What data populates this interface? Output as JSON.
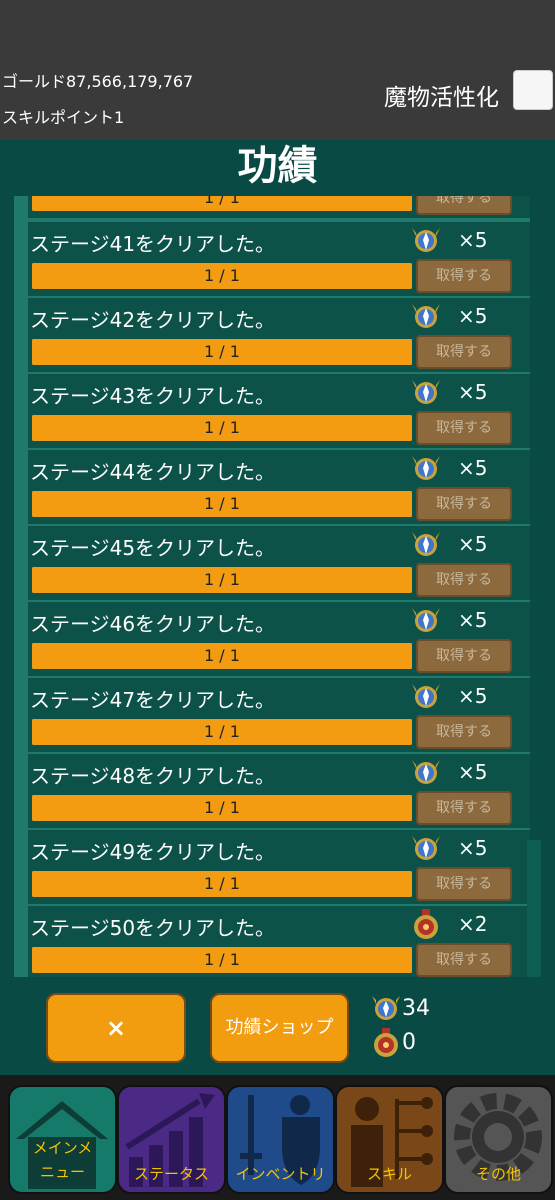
{
  "header": {
    "gold_label": "ゴールド87,566,179,767",
    "skill_point_label": "スキルポイント1",
    "monster_toggle_label": "魔物活性化"
  },
  "panel": {
    "title": "功績",
    "partial_top_row": {
      "progress": "1 / 1",
      "button": "取得する",
      "fraction": 1.0
    },
    "rows": [
      {
        "title": "ステージ41をクリアした。",
        "reward_icon": "blue-medal-icon",
        "multiplier": "×5",
        "progress": "1 / 1",
        "button": "取得する",
        "fraction": 1.0
      },
      {
        "title": "ステージ42をクリアした。",
        "reward_icon": "blue-medal-icon",
        "multiplier": "×5",
        "progress": "1 / 1",
        "button": "取得する",
        "fraction": 1.0
      },
      {
        "title": "ステージ43をクリアした。",
        "reward_icon": "blue-medal-icon",
        "multiplier": "×5",
        "progress": "1 / 1",
        "button": "取得する",
        "fraction": 1.0
      },
      {
        "title": "ステージ44をクリアした。",
        "reward_icon": "blue-medal-icon",
        "multiplier": "×5",
        "progress": "1 / 1",
        "button": "取得する",
        "fraction": 1.0
      },
      {
        "title": "ステージ45をクリアした。",
        "reward_icon": "blue-medal-icon",
        "multiplier": "×5",
        "progress": "1 / 1",
        "button": "取得する",
        "fraction": 1.0
      },
      {
        "title": "ステージ46をクリアした。",
        "reward_icon": "blue-medal-icon",
        "multiplier": "×5",
        "progress": "1 / 1",
        "button": "取得する",
        "fraction": 1.0
      },
      {
        "title": "ステージ47をクリアした。",
        "reward_icon": "blue-medal-icon",
        "multiplier": "×5",
        "progress": "1 / 1",
        "button": "取得する",
        "fraction": 1.0
      },
      {
        "title": "ステージ48をクリアした。",
        "reward_icon": "blue-medal-icon",
        "multiplier": "×5",
        "progress": "1 / 1",
        "button": "取得する",
        "fraction": 1.0
      },
      {
        "title": "ステージ49をクリアした。",
        "reward_icon": "blue-medal-icon",
        "multiplier": "×5",
        "progress": "1 / 1",
        "button": "取得する",
        "fraction": 1.0
      },
      {
        "title": "ステージ50をクリアした。",
        "reward_icon": "red-medal-icon",
        "multiplier": "×2",
        "progress": "1 / 1",
        "button": "取得する",
        "fraction": 1.0
      }
    ],
    "close_label": "×",
    "shop_label": "功績ショップ",
    "blue_medal_count": "34",
    "red_medal_count": "0"
  },
  "nav": {
    "items": [
      {
        "label": "メインメニュー",
        "line1": "メインメ",
        "line2": "ニュー",
        "icon": "house-icon",
        "color": "#167a6a"
      },
      {
        "label": "ステータス",
        "icon": "chart-arrow-icon",
        "color": "#4b2a86"
      },
      {
        "label": "インベントリ",
        "icon": "sword-shield-icon",
        "color": "#1f4b8a"
      },
      {
        "label": "スキル",
        "icon": "skill-tree-icon",
        "color": "#7a4718"
      },
      {
        "label": "その他",
        "icon": "gear-icon",
        "color": "#555555"
      }
    ]
  },
  "colors": {
    "panel_bg": "#0a4a45",
    "progress_fill": "#f39c12",
    "accent_orange": "#f29d10",
    "nav_label": "#f5c400"
  }
}
